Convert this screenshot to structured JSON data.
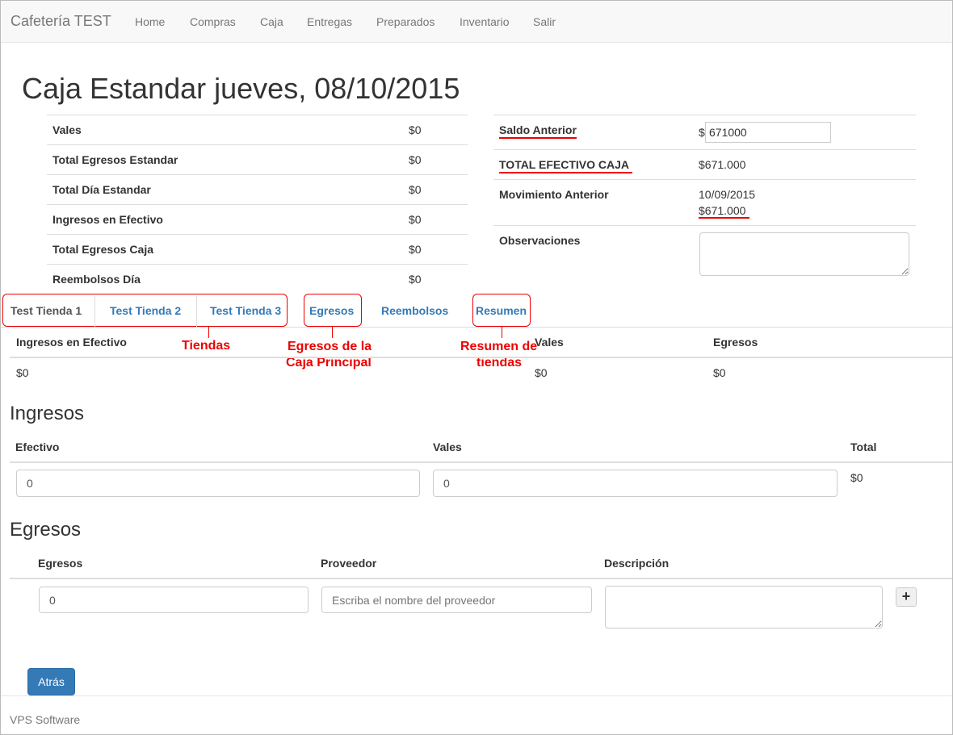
{
  "navbar": {
    "brand": "Cafetería TEST",
    "items": [
      "Home",
      "Compras",
      "Caja",
      "Entregas",
      "Preparados",
      "Inventario",
      "Salir"
    ]
  },
  "page_title": "Caja Estandar jueves, 08/10/2015",
  "summary_left": [
    {
      "label": "Vales",
      "value": "$0"
    },
    {
      "label": "Total Egresos Estandar",
      "value": "$0"
    },
    {
      "label": "Total Día Estandar",
      "value": "$0"
    },
    {
      "label": "Ingresos en Efectivo",
      "value": "$0"
    },
    {
      "label": "Total Egresos Caja",
      "value": "$0"
    },
    {
      "label": "Reembolsos Día",
      "value": "$0"
    }
  ],
  "summary_right": {
    "saldo_label": "Saldo Anterior",
    "saldo_prefix": "$",
    "saldo_value": "671000",
    "total_label": "TOTAL EFECTIVO CAJA",
    "total_value": "$671.000",
    "mov_label": "Movimiento Anterior",
    "mov_date": "10/09/2015",
    "mov_value": "$671.000",
    "obs_label": "Observaciones",
    "obs_value": ""
  },
  "tabs": [
    "Test Tienda 1",
    "Test Tienda 2",
    "Test Tienda 3",
    "Egresos",
    "Reembolsos",
    "Resumen"
  ],
  "annotations": {
    "tiendas": "Tiendas",
    "egresos_line1": "Egresos de la",
    "egresos_line2": "Caja Principal",
    "resumen_line1": "Resumen de",
    "resumen_line2": "tiendas"
  },
  "store_table": {
    "headers": [
      "Ingresos en Efectivo",
      "Vales",
      "Egresos"
    ],
    "values": [
      "$0",
      "$0",
      "$0"
    ]
  },
  "ingresos": {
    "title": "Ingresos",
    "headers": [
      "Efectivo",
      "Vales",
      "Total"
    ],
    "efectivo_value": "0",
    "vales_value": "0",
    "total_value": "$0"
  },
  "egresos": {
    "title": "Egresos",
    "headers": [
      "Egresos",
      "Proveedor",
      "Descripción"
    ],
    "egresos_value": "0",
    "proveedor_placeholder": "Escriba el nombre del proveedor",
    "descripcion_value": "",
    "add_label": "+"
  },
  "back_label": "Atrás",
  "footer": "VPS Software"
}
